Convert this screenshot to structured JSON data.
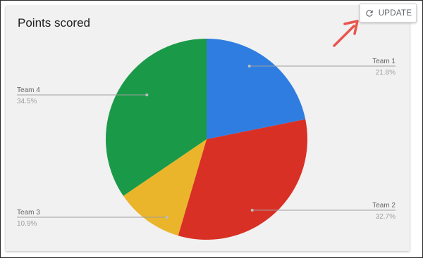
{
  "card": {
    "title": "Points scored"
  },
  "toolbar": {
    "update_label": "UPDATE",
    "refresh_icon": "refresh-icon"
  },
  "annotation": {
    "arrow_icon": "red-arrow-icon",
    "arrow_color": "#e8554e"
  },
  "chart_data": {
    "type": "pie",
    "title": "Points scored",
    "slices": [
      {
        "label": "Team 1",
        "pct_label": "21.8%",
        "value": 21.8,
        "color": "#2f7de1"
      },
      {
        "label": "Team 2",
        "pct_label": "32.7%",
        "value": 32.7,
        "color": "#d93025"
      },
      {
        "label": "Team 3",
        "pct_label": "10.9%",
        "value": 10.9,
        "color": "#eab52b"
      },
      {
        "label": "Team 4",
        "pct_label": "34.5%",
        "value": 34.5,
        "color": "#1a9a48"
      }
    ],
    "start_angle_deg": 0,
    "direction": "clockwise",
    "label_style": "leader-lines"
  }
}
